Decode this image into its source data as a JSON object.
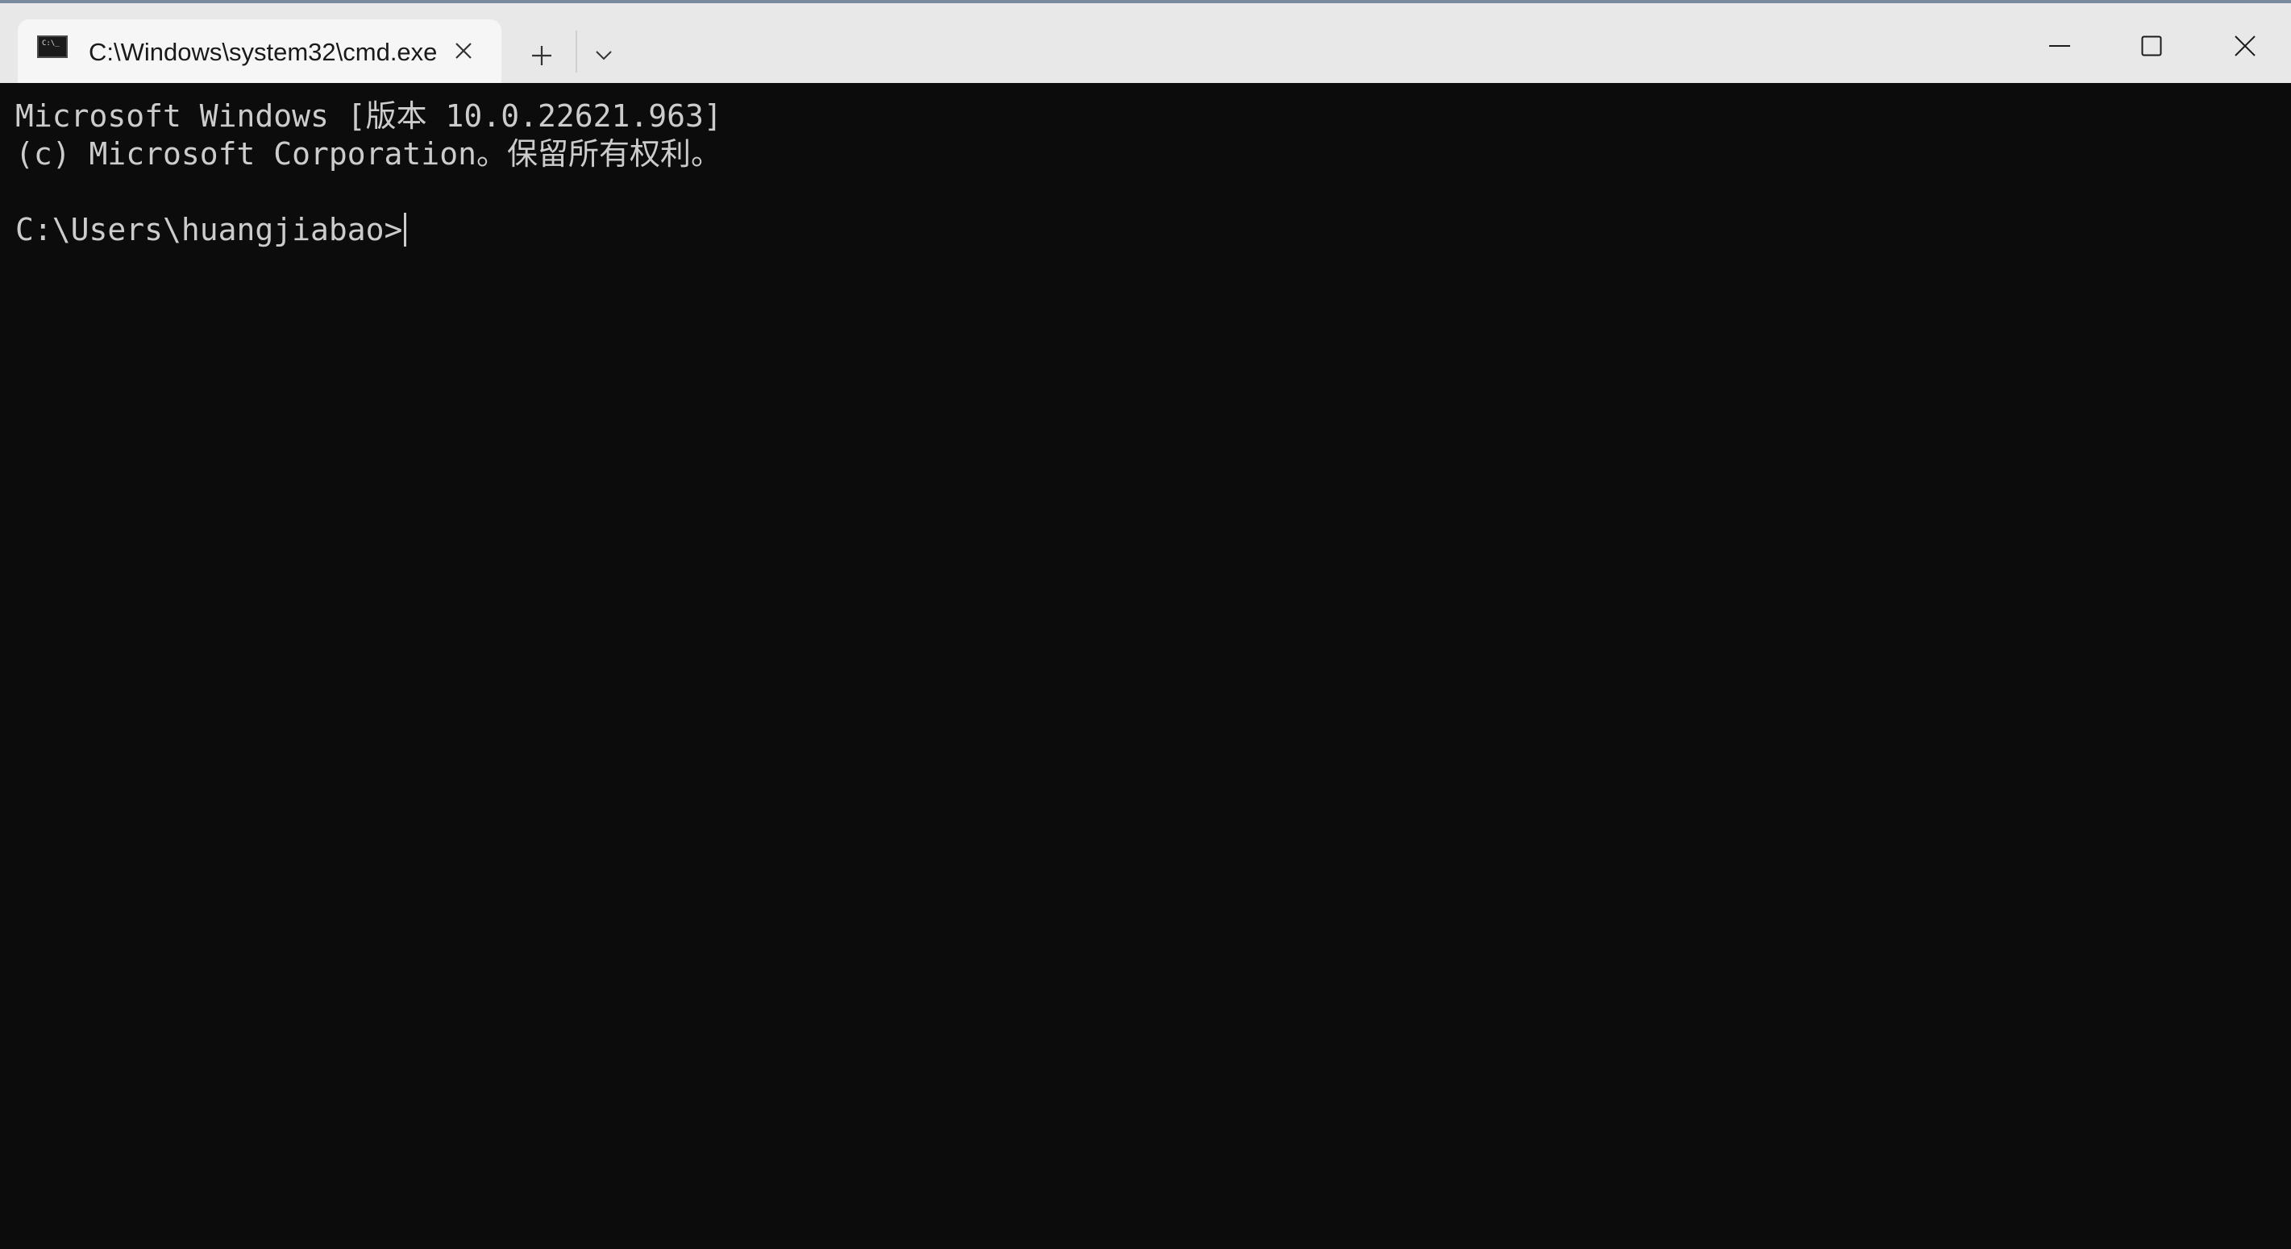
{
  "titlebar": {
    "tab": {
      "title": "C:\\Windows\\system32\\cmd.exe",
      "icon": "cmd-terminal-icon",
      "icon_glyph": "C:\\_",
      "close_icon": "close-icon"
    },
    "new_tab_icon": "plus-icon",
    "dropdown_icon": "chevron-down-icon",
    "window_controls": {
      "minimize_icon": "minimize-icon",
      "maximize_icon": "maximize-icon",
      "close_icon": "close-icon"
    }
  },
  "terminal": {
    "lines": [
      "Microsoft Windows [版本 10.0.22621.963]",
      "(c) Microsoft Corporation。保留所有权利。",
      "",
      "C:\\Users\\huangjiabao>"
    ],
    "colors": {
      "background": "#0c0c0c",
      "foreground": "#cccccc"
    }
  }
}
